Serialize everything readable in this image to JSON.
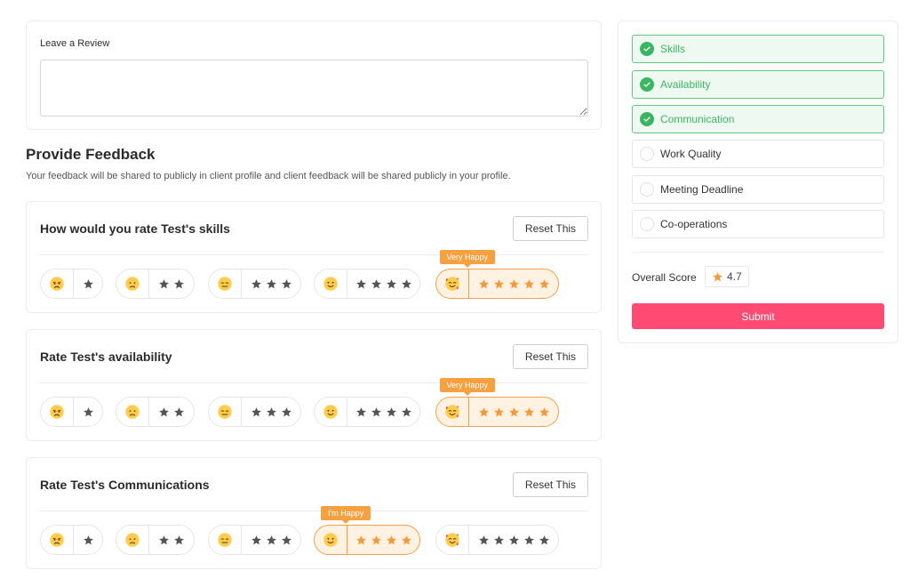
{
  "review": {
    "label": "Leave a Review",
    "value": "",
    "placeholder": ""
  },
  "feedback": {
    "title": "Provide Feedback",
    "subtitle": "Your feedback will be shared to publicly in client profile and client feedback will be shared publicly in your profile."
  },
  "questions": [
    {
      "question": "How would you rate Test's skills",
      "reset_label": "Reset This",
      "selected_stars": 5,
      "tooltip": "Very Happy"
    },
    {
      "question": "Rate Test's availability",
      "reset_label": "Reset This",
      "selected_stars": 5,
      "tooltip": "Very Happy"
    },
    {
      "question": "Rate Test's Communications",
      "reset_label": "Reset This",
      "selected_stars": 4,
      "tooltip": "I'm Happy"
    }
  ],
  "rating_options": [
    {
      "stars": 1,
      "icon": "angry-face-icon"
    },
    {
      "stars": 2,
      "icon": "worried-face-icon"
    },
    {
      "stars": 3,
      "icon": "neutral-face-icon"
    },
    {
      "stars": 4,
      "icon": "slight-smile-face-icon"
    },
    {
      "stars": 5,
      "icon": "smiling-hearts-face-icon"
    }
  ],
  "criteria": [
    {
      "label": "Skills",
      "done": true
    },
    {
      "label": "Availability",
      "done": true
    },
    {
      "label": "Communication",
      "done": true
    },
    {
      "label": "Work Quality",
      "done": false
    },
    {
      "label": "Meeting Deadline",
      "done": false
    },
    {
      "label": "Co-operations",
      "done": false
    }
  ],
  "overall": {
    "label": "Overall Score",
    "score": "4.7"
  },
  "submit_label": "Submit",
  "colors": {
    "accent": "#ff4b74",
    "selected_orange": "#f59a3c",
    "success_green": "#3bb563",
    "star_gray": "#555555"
  }
}
